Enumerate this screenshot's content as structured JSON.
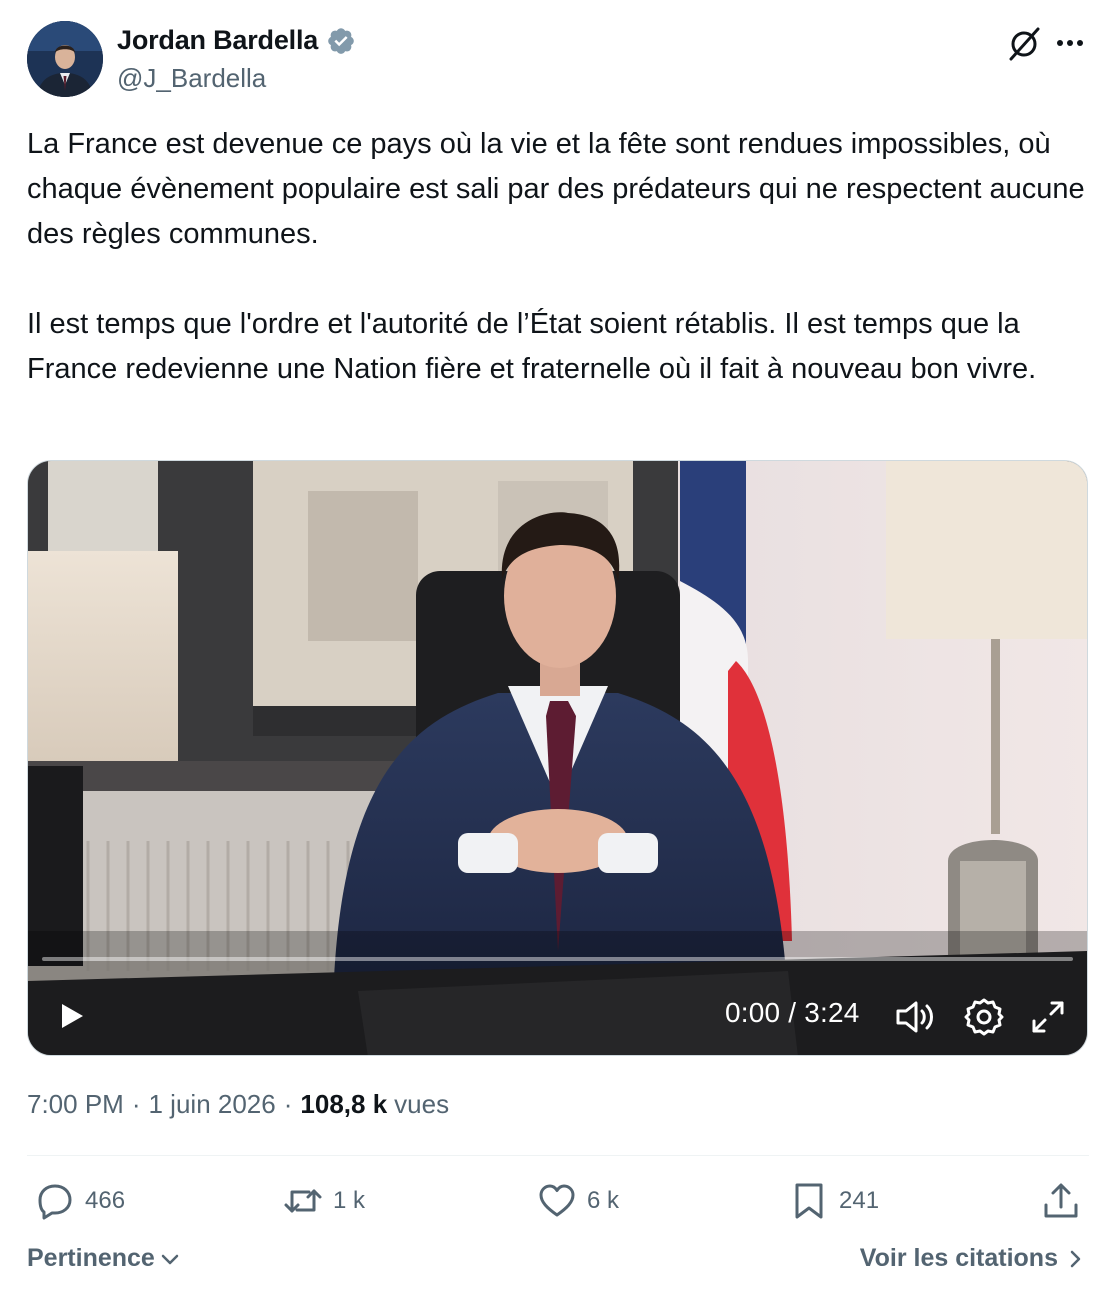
{
  "author": {
    "name": "Jordan Bardella",
    "handle": "@J_Bardella",
    "verified_color": "#829aab"
  },
  "tweet": {
    "text": "La France est devenue ce pays où la vie et la fête sont rendues impossibles, où chaque évènement populaire est sali par des prédateurs qui ne respectent aucune des règles communes.\n\nIl est temps que l'ordre et l'autorité de l’État soient rétablis. Il est temps que la France redevienne une Nation fière et fraternelle où il fait à nouveau bon vivre."
  },
  "video": {
    "time": "0:00 / 3:24",
    "progress": 0
  },
  "meta": {
    "time": "7:00 PM",
    "date": "1 juin 2026",
    "views_count": "108,8 k",
    "views_label": "vues"
  },
  "actions": {
    "replies": "466",
    "reposts": "1 k",
    "likes": "6 k",
    "bookmarks": "241"
  },
  "footer": {
    "sort_label": "Pertinence",
    "quotes_label": "Voir les citations"
  },
  "colors": {
    "text": "#0f1419",
    "secondary": "#536471",
    "divider": "#eff3f4"
  }
}
